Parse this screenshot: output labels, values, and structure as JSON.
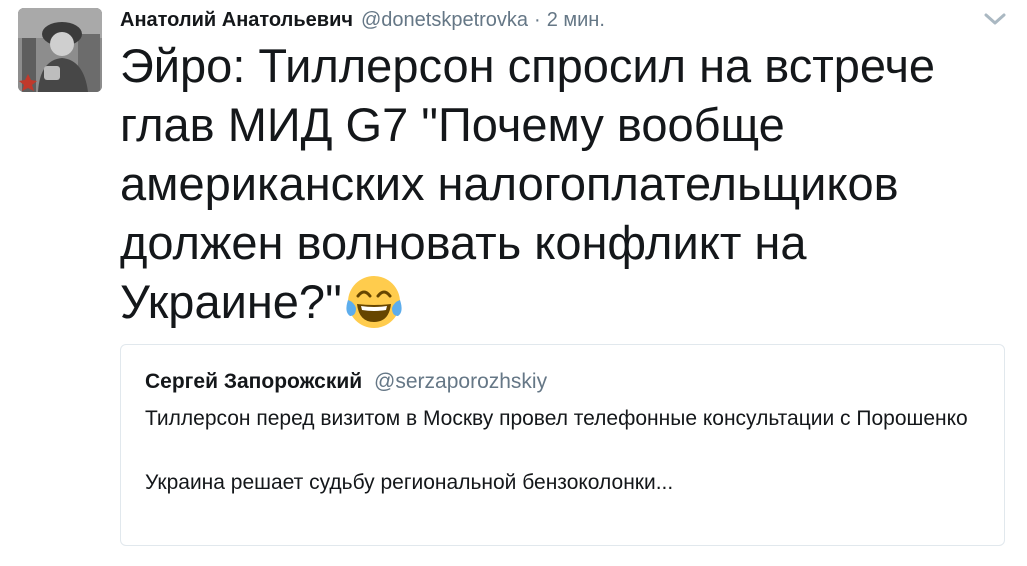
{
  "tweet": {
    "author_name": "Анатолий Анатольевич",
    "author_handle": "@donetskpetrovka",
    "separator": "·",
    "timestamp": "2 мин.",
    "text": "Эйро: Тиллерсон спросил на встрече глав МИД G7 \"Почему вообще американских налогоплательщиков должен волновать конфликт на Украине?\"",
    "emoji": "face-with-tears-of-joy",
    "icons": {
      "menu": "chevron-down-icon"
    }
  },
  "quoted_tweet": {
    "author_name": "Сергей Запорожский",
    "author_handle": "@serzaporozhskiy",
    "text_line_1": "Тиллерсон перед визитом в Москву провел телефонные консультации с Порошенко",
    "text_line_2": "Украина решает судьбу региональной бензоколонки..."
  },
  "colors": {
    "text": "#14171a",
    "secondary": "#657786",
    "border": "#e1e8ed"
  }
}
